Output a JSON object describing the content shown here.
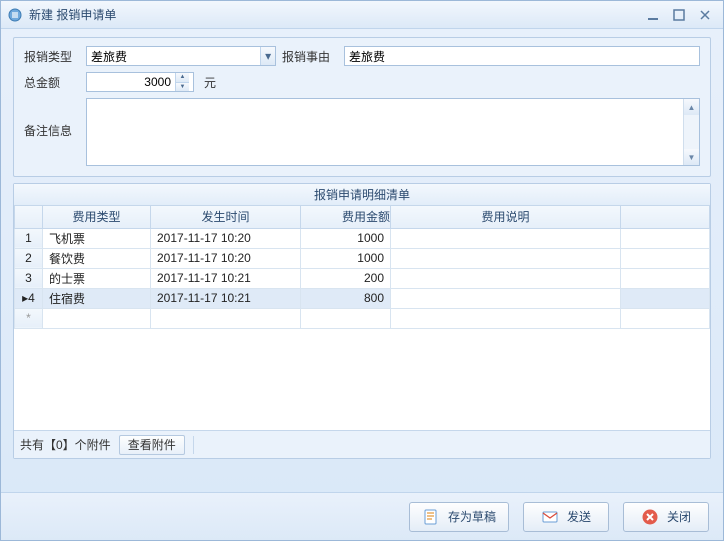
{
  "window": {
    "title": "新建 报销申请单"
  },
  "form": {
    "type_label": "报销类型",
    "type_value": "差旅费",
    "reason_label": "报销事由",
    "reason_value": "差旅费",
    "total_label": "总金额",
    "total_value": "3000",
    "unit": "元",
    "remarks_label": "备注信息",
    "remarks_value": ""
  },
  "grid": {
    "title": "报销申请明细清单",
    "headers": {
      "type": "费用类型",
      "time": "发生时间",
      "amount": "费用金额",
      "desc": "费用说明"
    },
    "rows": [
      {
        "n": "1",
        "type": "飞机票",
        "time": "2017-11-17 10:20",
        "amount": "1000",
        "desc": ""
      },
      {
        "n": "2",
        "type": "餐饮费",
        "time": "2017-11-17 10:20",
        "amount": "1000",
        "desc": ""
      },
      {
        "n": "3",
        "type": "的士票",
        "time": "2017-11-17 10:21",
        "amount": "200",
        "desc": ""
      },
      {
        "n": "4",
        "type": "住宿费",
        "time": "2017-11-17 10:21",
        "amount": "800",
        "desc": ""
      }
    ],
    "selrow_marker": "▸",
    "newrow_marker": "*"
  },
  "attachments": {
    "text": "共有【0】个附件",
    "view_btn": "查看附件"
  },
  "footer": {
    "draft": "存为草稿",
    "send": "发送",
    "close": "关闭"
  }
}
